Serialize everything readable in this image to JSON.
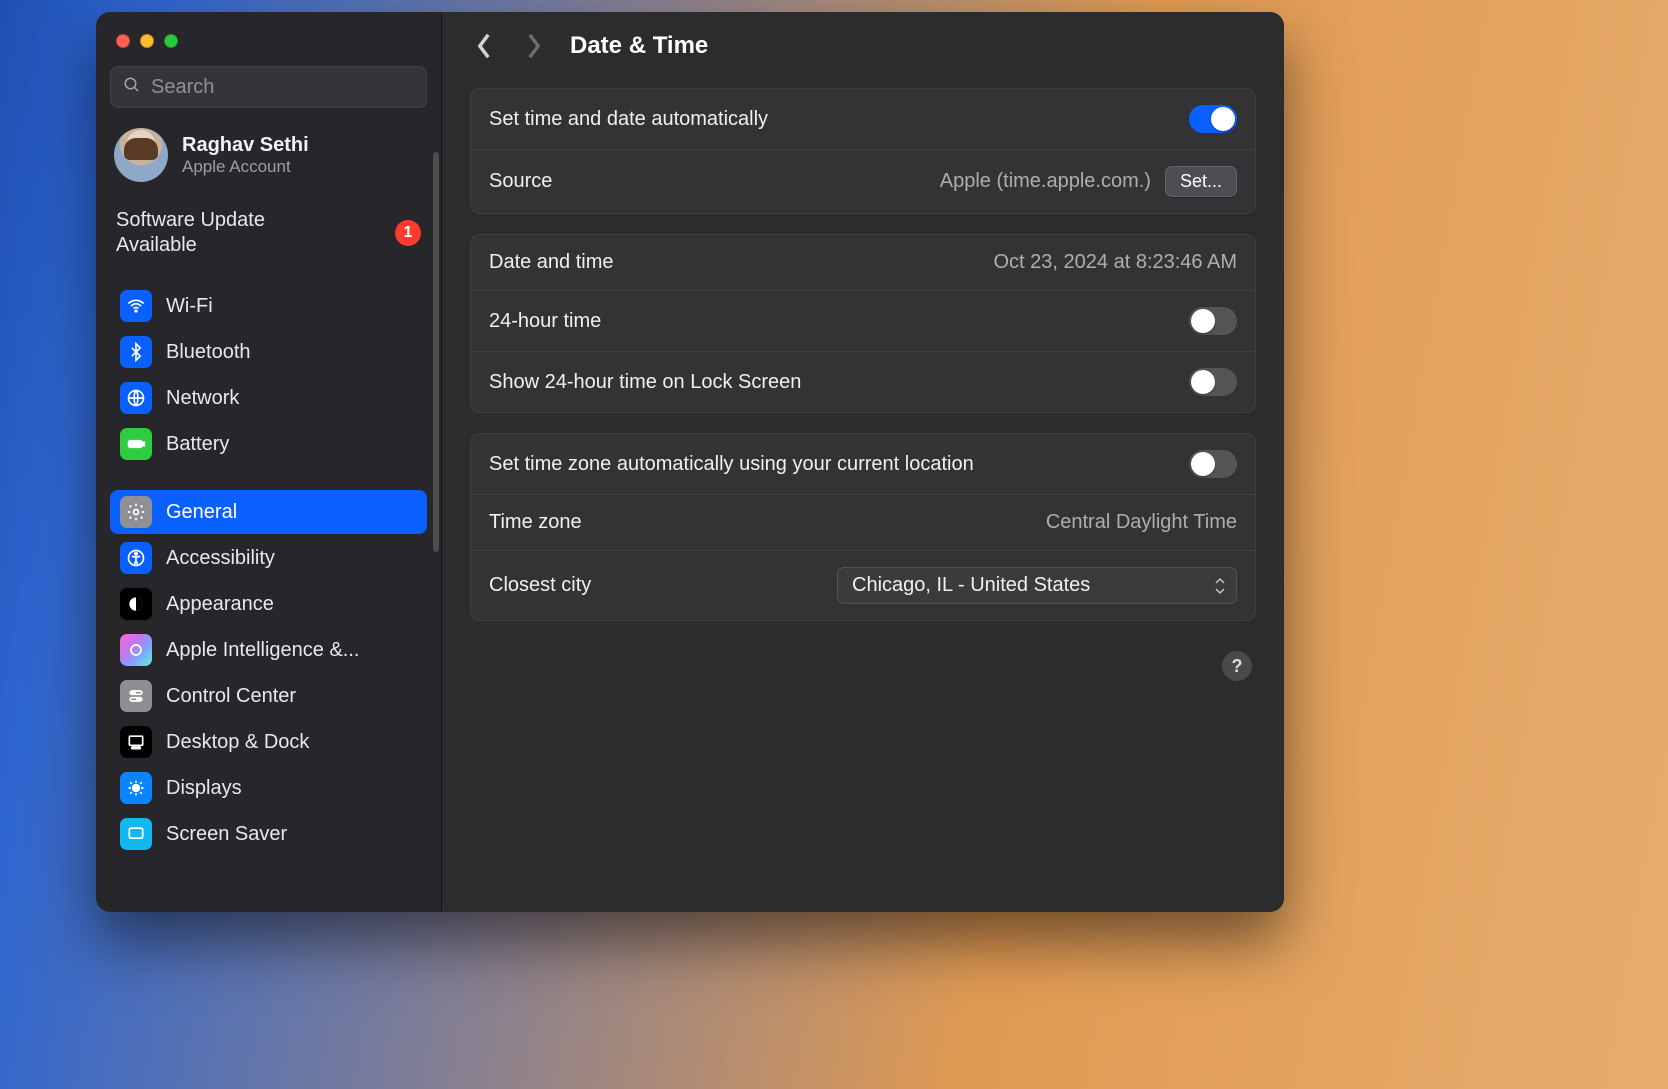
{
  "search": {
    "placeholder": "Search"
  },
  "user": {
    "name": "Raghav Sethi",
    "sub": "Apple Account"
  },
  "update": {
    "text": "Software Update Available",
    "count": "1"
  },
  "sidebar": {
    "items": [
      {
        "label": "Wi-Fi"
      },
      {
        "label": "Bluetooth"
      },
      {
        "label": "Network"
      },
      {
        "label": "Battery"
      },
      {
        "label": "General"
      },
      {
        "label": "Accessibility"
      },
      {
        "label": "Appearance"
      },
      {
        "label": "Apple Intelligence &..."
      },
      {
        "label": "Control Center"
      },
      {
        "label": "Desktop & Dock"
      },
      {
        "label": "Displays"
      },
      {
        "label": "Screen Saver"
      }
    ]
  },
  "header": {
    "title": "Date & Time"
  },
  "rows": {
    "auto_time": "Set time and date automatically",
    "source_label": "Source",
    "source_value": "Apple (time.apple.com.)",
    "set_btn": "Set...",
    "datetime_label": "Date and time",
    "datetime_value": "Oct 23, 2024 at 8:23:46 AM",
    "h24": "24-hour time",
    "lock24": "Show 24-hour time on Lock Screen",
    "auto_tz": "Set time zone automatically using your current location",
    "tz_label": "Time zone",
    "tz_value": "Central Daylight Time",
    "city_label": "Closest city",
    "city_value": "Chicago, IL - United States"
  },
  "help": "?",
  "toggles": {
    "auto_time": true,
    "h24": false,
    "lock24": false,
    "auto_tz": false
  },
  "icons": {
    "wifi_bg": "#0a60ff",
    "bluetooth_bg": "#0a60ff",
    "network_bg": "#0a60ff",
    "battery_bg": "#2ecc40",
    "general_bg": "#8e8e93",
    "accessibility_bg": "#0a60ff",
    "appearance_bg": "#000000",
    "ai_bg": "linear-gradient(135deg,#ff6ad5,#c774e8,#7aa8ff,#6cf0c2)",
    "cc_bg": "#8e8e93",
    "dock_bg": "#000000",
    "displays_bg": "#0a84ff",
    "saver_bg": "#14b8f0"
  }
}
